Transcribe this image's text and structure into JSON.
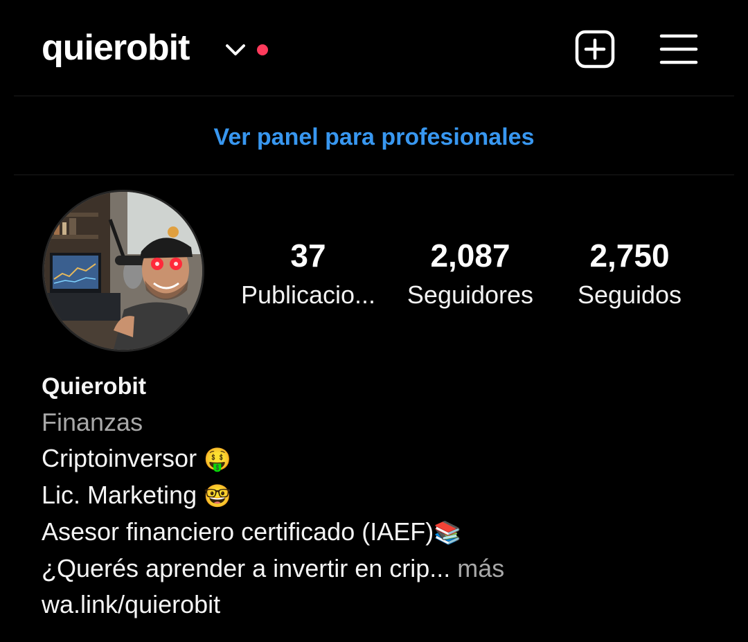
{
  "header": {
    "username": "quierobit",
    "icons": {
      "switch_account": "chevron-down-icon",
      "notification": "notification-dot",
      "new_post": "plus-square-icon",
      "menu": "hamburger-menu-icon"
    },
    "colors": {
      "notification_dot": "#ff3b5c"
    }
  },
  "dashboard": {
    "label": "Ver panel para profesionales",
    "color": "#3897f0"
  },
  "profile": {
    "avatar": "profile-photo",
    "stats": [
      {
        "value": "37",
        "label": "Publicacio..."
      },
      {
        "value": "2,087",
        "label": "Seguidores"
      },
      {
        "value": "2,750",
        "label": "Seguidos"
      }
    ]
  },
  "bio": {
    "name": "Quierobit",
    "category": "Finanzas",
    "lines": [
      {
        "text": "Criptoinversor ",
        "emoji": "🤑"
      },
      {
        "text": "Lic. Marketing ",
        "emoji": "🤓"
      },
      {
        "text": "Asesor financiero certificado (IAEF)",
        "emoji": "📚"
      }
    ],
    "teaser": "¿Querés aprender a invertir en crip...",
    "more": " más",
    "link": "wa.link/quierobit"
  }
}
